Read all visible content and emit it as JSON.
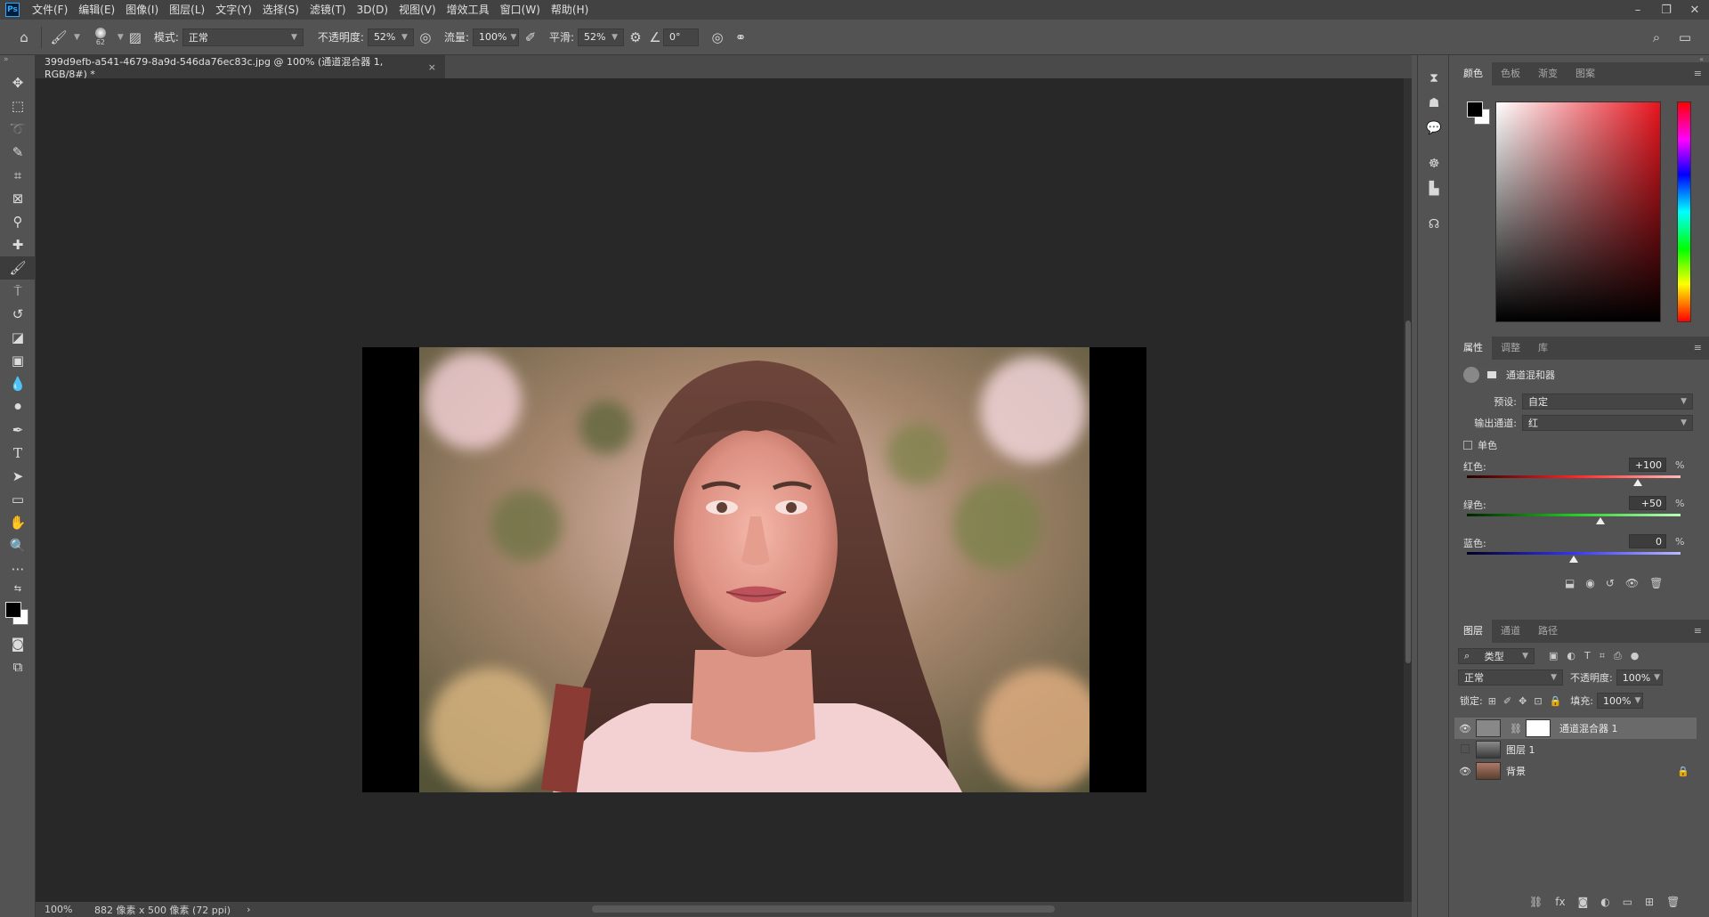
{
  "menubar": {
    "logo": "Ps",
    "items": [
      "文件(F)",
      "编辑(E)",
      "图像(I)",
      "图层(L)",
      "文字(Y)",
      "选择(S)",
      "滤镜(T)",
      "3D(D)",
      "视图(V)",
      "增效工具",
      "窗口(W)",
      "帮助(H)"
    ],
    "minimize": "–",
    "restore": "❐",
    "close": "✕"
  },
  "options": {
    "brush_size": "62",
    "mode_label": "模式:",
    "mode_value": "正常",
    "opacity_label": "不透明度:",
    "opacity_value": "52%",
    "flow_label": "流量:",
    "flow_value": "100%",
    "smooth_label": "平滑:",
    "smooth_value": "52%",
    "angle_value": "0°"
  },
  "document": {
    "tab_title": "399d9efb-a541-4679-8a9d-546da76ec83c.jpg @ 100% (通道混合器 1, RGB/8#) *",
    "tab_close": "×",
    "zoom": "100%",
    "dimensions": "882 像素 x 500 像素 (72 ppi)",
    "status_arrow": "›"
  },
  "color_panel": {
    "tabs": [
      "颜色",
      "色板",
      "渐变",
      "图案"
    ],
    "fg_color": "#000000",
    "bg_color": "#ffffff",
    "hue_color": "#e8141e"
  },
  "properties_panel": {
    "tabs": [
      "属性",
      "调整",
      "库"
    ],
    "title": "通道混和器",
    "preset_label": "预设:",
    "preset_value": "自定",
    "output_label": "输出通道:",
    "output_value": "红",
    "mono_label": "单色",
    "channels": [
      {
        "label": "红色:",
        "value": "+100",
        "pct": "%",
        "position": 0.8
      },
      {
        "label": "绿色:",
        "value": "+50",
        "pct": "%",
        "position": 0.625
      },
      {
        "label": "蓝色:",
        "value": "0",
        "pct": "%",
        "position": 0.5
      }
    ]
  },
  "layers_panel": {
    "tabs": [
      "图层",
      "通道",
      "路径"
    ],
    "filter_label": "类型",
    "blend_mode": "正常",
    "opacity_label": "不透明度:",
    "opacity_value": "100%",
    "lock_label": "锁定:",
    "fill_label": "填充:",
    "fill_value": "100%",
    "layers": [
      {
        "name": "通道混合器 1",
        "visible": true,
        "selected": true
      },
      {
        "name": "图层 1",
        "visible": false,
        "selected": false
      },
      {
        "name": "背景",
        "visible": true,
        "selected": false
      }
    ]
  }
}
